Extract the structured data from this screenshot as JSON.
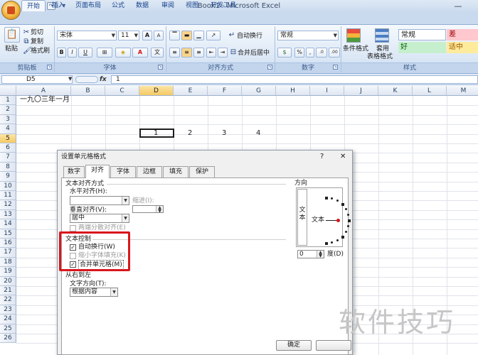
{
  "window": {
    "title": "Book1 - Microsoft Excel",
    "minimize_glyph": "—"
  },
  "qat": {
    "save_glyph": "▣",
    "undo_glyph": "↶",
    "redo_glyph": "↷",
    "more_glyph": "▾"
  },
  "tabs": [
    "开始",
    "插入",
    "页面布局",
    "公式",
    "数据",
    "审阅",
    "视图",
    "开发工具"
  ],
  "ribbon": {
    "clipboard": {
      "paste": "粘贴",
      "cut": "剪切",
      "copy": "复制",
      "format_painter": "格式刷",
      "label": "剪贴板"
    },
    "font": {
      "name": "宋体",
      "size": "11",
      "grow": "A",
      "shrink": "A",
      "bold": "B",
      "italic": "I",
      "underline": "U",
      "font_color": "A",
      "label": "字体"
    },
    "alignment": {
      "wrap": "自动换行",
      "merge": "合并后居中",
      "label": "对齐方式"
    },
    "number": {
      "format": "常规",
      "percent": "%",
      "comma": ",",
      "label": "数字"
    },
    "styles": {
      "conditional": "条件格式",
      "table_format": "套用",
      "table_format2": "表格格式",
      "cell_styles": [
        "常规",
        "差",
        "好",
        "适中"
      ],
      "label": "样式"
    }
  },
  "formula_bar": {
    "name_box": "D5",
    "fx": "fx",
    "value": "1"
  },
  "sheet": {
    "columns": [
      "A",
      "B",
      "C",
      "D",
      "E",
      "F",
      "G",
      "H",
      "I",
      "J",
      "K",
      "L",
      "M"
    ],
    "rows": [
      "1",
      "2",
      "3",
      "4",
      "5",
      "6",
      "7",
      "8",
      "9",
      "10",
      "11",
      "12",
      "13",
      "14",
      "15",
      "16",
      "17",
      "18",
      "19",
      "20",
      "21",
      "22",
      "23",
      "24",
      "25",
      "26"
    ],
    "cells": {
      "A1": "一九〇三年一月",
      "D5": "1",
      "E5": "2",
      "F5": "3",
      "G5": "4"
    }
  },
  "dialog": {
    "title": "设置单元格格式",
    "help": "?",
    "close": "✕",
    "tabs": [
      "数字",
      "对齐",
      "字体",
      "边框",
      "填充",
      "保护"
    ],
    "text_alignment": {
      "heading": "文本对齐方式",
      "horizontal_label": "水平对齐(H):",
      "horizontal_value": "",
      "indent_label": "缩进(I):",
      "indent_value": "",
      "vertical_label": "垂直对齐(V):",
      "vertical_value": "居中",
      "distributed": "两端分散对齐(E)"
    },
    "text_control": {
      "heading": "文本控制",
      "wrap": "自动换行(W)",
      "shrink": "缩小字体填充(K)",
      "merge": "合并单元格(M)",
      "wrap_checked": true,
      "shrink_checked": false,
      "merge_checked": true
    },
    "rtl": {
      "heading": "从右到左",
      "direction_label": "文字方向(T):",
      "direction_value": "根据内容"
    },
    "orientation": {
      "heading": "方向",
      "vertical_text": "文本",
      "horizontal_text": "文本",
      "degree_value": "0",
      "degree_label": "度(D)"
    },
    "ok": "确定"
  },
  "watermark": "软件技巧"
}
